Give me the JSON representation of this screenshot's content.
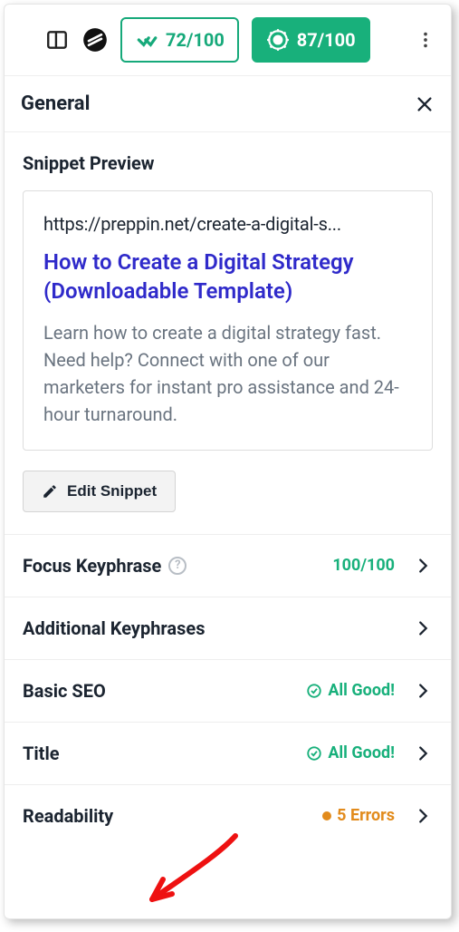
{
  "topbar": {
    "readability_score": "72/100",
    "seo_score": "87/100"
  },
  "section": {
    "title": "General"
  },
  "snippet": {
    "heading": "Snippet Preview",
    "url": "https://preppin.net/create-a-digital-s...",
    "title": "How to Create a Digital Strategy (Downloadable Template)",
    "description": "Learn how to create a digital strategy fast. Need help? Connect with one of our marketers for instant pro assistance and 24-hour turnaround.",
    "edit_label": "Edit Snippet"
  },
  "rows": {
    "focus_keyphrase": {
      "label": "Focus Keyphrase",
      "status": "100/100"
    },
    "additional_keyphrases": {
      "label": "Additional Keyphrases"
    },
    "basic_seo": {
      "label": "Basic SEO",
      "status": "All Good!"
    },
    "title_row": {
      "label": "Title",
      "status": "All Good!"
    },
    "readability": {
      "label": "Readability",
      "status": "5 Errors"
    }
  }
}
